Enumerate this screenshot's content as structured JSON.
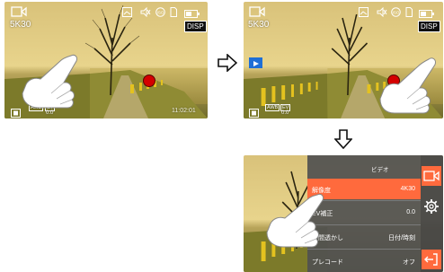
{
  "hud": {
    "resolution": "5K30",
    "disp_label": "DISP",
    "timestamp": "11:02:01",
    "awb_badge": "AWB",
    "ev_badge": "EV",
    "ev_value": "0.0",
    "iso_badge": "ISO"
  },
  "menu": {
    "title": "ビデオ",
    "items": [
      {
        "label": "解像度",
        "value": "4K30",
        "selected": true
      },
      {
        "label": "EV補正",
        "value": "0.0",
        "selected": false
      },
      {
        "label": "時間透かし",
        "value": "日付/時刻",
        "selected": false
      },
      {
        "label": "プレコード",
        "value": "オフ",
        "selected": false
      }
    ]
  },
  "icons": {
    "top": [
      "video-camera-icon",
      "image-icon",
      "mute-icon",
      "auto-iso-icon",
      "sd-card-icon",
      "battery-icon"
    ],
    "bottom": [
      "grid-icon",
      "awb-icon",
      "ev-icon"
    ],
    "rail": [
      "video-mode-icon",
      "settings-gear-icon",
      "exit-icon"
    ],
    "record": "record-button",
    "playback": "playback-icon",
    "flow": [
      "arrow-right-icon",
      "arrow-down-icon"
    ],
    "gesture": "tap-hand-icon"
  },
  "colors": {
    "accent_orange": "#ff6a3d",
    "record_red": "#d40000",
    "playback_blue": "#1e6fd6",
    "menu_bg": "#505050"
  }
}
